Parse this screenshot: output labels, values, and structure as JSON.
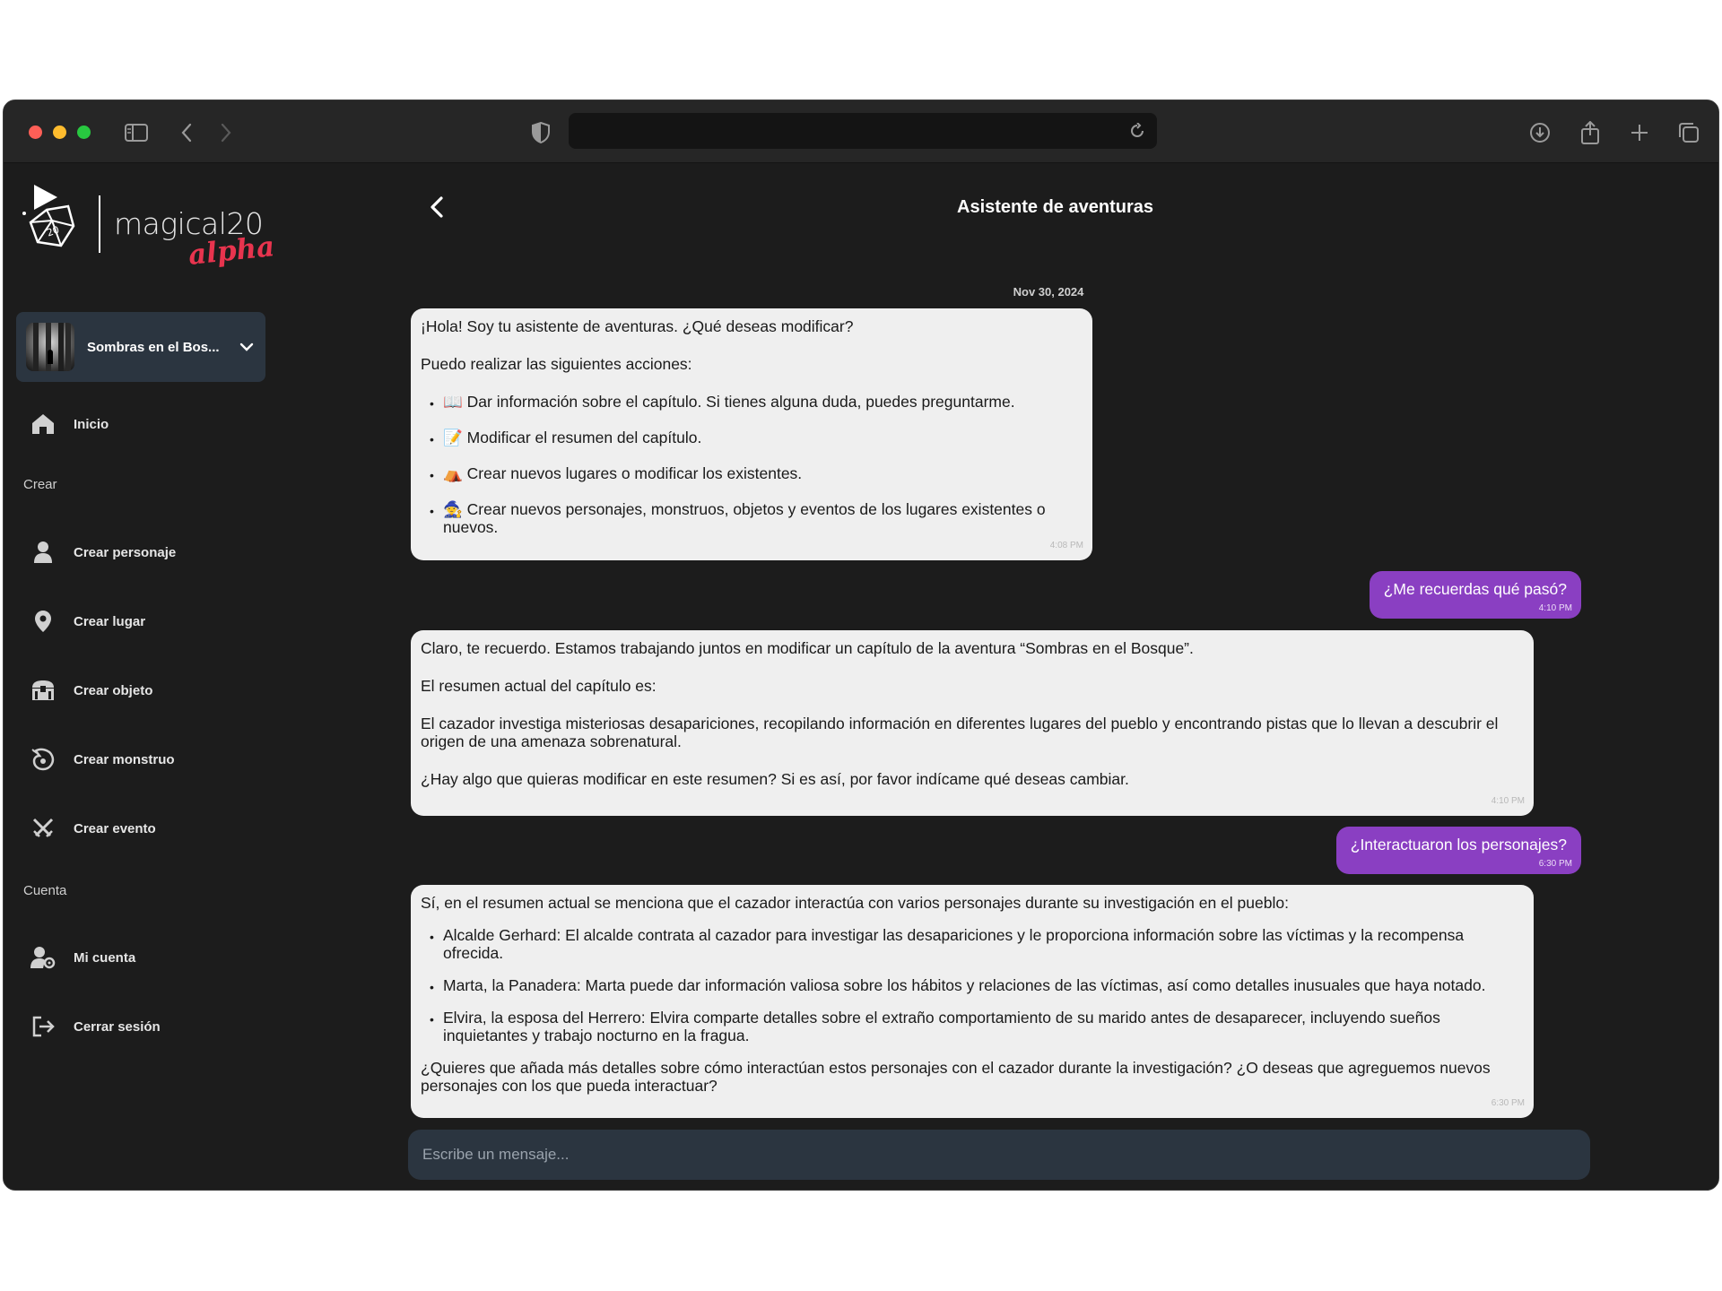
{
  "app": {
    "logo_text": "magical20",
    "logo_tag": "alpha"
  },
  "campaign": {
    "name": "Sombras en el Bos..."
  },
  "sidebar": {
    "home": "Inicio",
    "section_create": "Crear",
    "create_items": [
      {
        "label": "Crear personaje",
        "icon": "person-icon"
      },
      {
        "label": "Crear lugar",
        "icon": "location-pin-icon"
      },
      {
        "label": "Crear objeto",
        "icon": "chest-icon"
      },
      {
        "label": "Crear monstruo",
        "icon": "dragon-icon"
      },
      {
        "label": "Crear evento",
        "icon": "crossed-swords-icon"
      }
    ],
    "section_account": "Cuenta",
    "account_items": [
      {
        "label": "Mi cuenta",
        "icon": "user-gear-icon"
      },
      {
        "label": "Cerrar sesión",
        "icon": "logout-icon"
      }
    ]
  },
  "chat": {
    "title": "Asistente de aventuras",
    "date": "Nov 30, 2024",
    "msg1": {
      "greeting": "¡Hola! Soy tu asistente de aventuras. ¿Qué deseas modificar?",
      "intro": "Puedo realizar las siguientes acciones:",
      "items": [
        "📖 Dar información sobre el capítulo. Si tienes alguna duda, puedes preguntarme.",
        "📝 Modificar el resumen del capítulo.",
        "⛺ Crear nuevos lugares o modificar los existentes.",
        "🧙 Crear nuevos personajes, monstruos, objetos y eventos de los lugares existentes o nuevos."
      ],
      "time": "4:08 PM"
    },
    "user1": {
      "text": "¿Me recuerdas qué pasó?",
      "time": "4:10 PM"
    },
    "msg2": {
      "p1": "Claro, te recuerdo. Estamos trabajando juntos en modificar un capítulo de la aventura “Sombras en el Bosque”.",
      "p2": "El resumen actual del capítulo es:",
      "p3": "El cazador investiga misteriosas desapariciones, recopilando información en diferentes lugares del pueblo y encontrando pistas que lo llevan a descubrir el origen de una amenaza sobrenatural.",
      "p4": "¿Hay algo que quieras modificar en este resumen? Si es así, por favor indícame qué deseas cambiar.",
      "time": "4:10 PM"
    },
    "user2": {
      "text": "¿Interactuaron los personajes?",
      "time": "6:30 PM"
    },
    "msg3": {
      "intro": "Sí, en el resumen actual se menciona que el cazador interactúa con varios personajes durante su investigación en el pueblo:",
      "items": [
        "Alcalde Gerhard: El alcalde contrata al cazador para investigar las desapariciones y le proporciona información sobre las víctimas y la recompensa ofrecida.",
        "Marta, la Panadera: Marta puede dar información valiosa sobre los hábitos y relaciones de las víctimas, así como detalles inusuales que haya notado.",
        "Elvira, la esposa del Herrero: Elvira comparte detalles sobre el extraño comportamiento de su marido antes de desaparecer, incluyendo sueños inquietantes y trabajo nocturno en la fragua."
      ],
      "outro": "¿Quieres que añada más detalles sobre cómo interactúan estos personajes con el cazador durante la investigación? ¿O deseas que agreguemos nuevos personajes con los que pueda interactuar?",
      "time": "6:30 PM"
    },
    "composer_placeholder": "Escribe un mensaje..."
  }
}
